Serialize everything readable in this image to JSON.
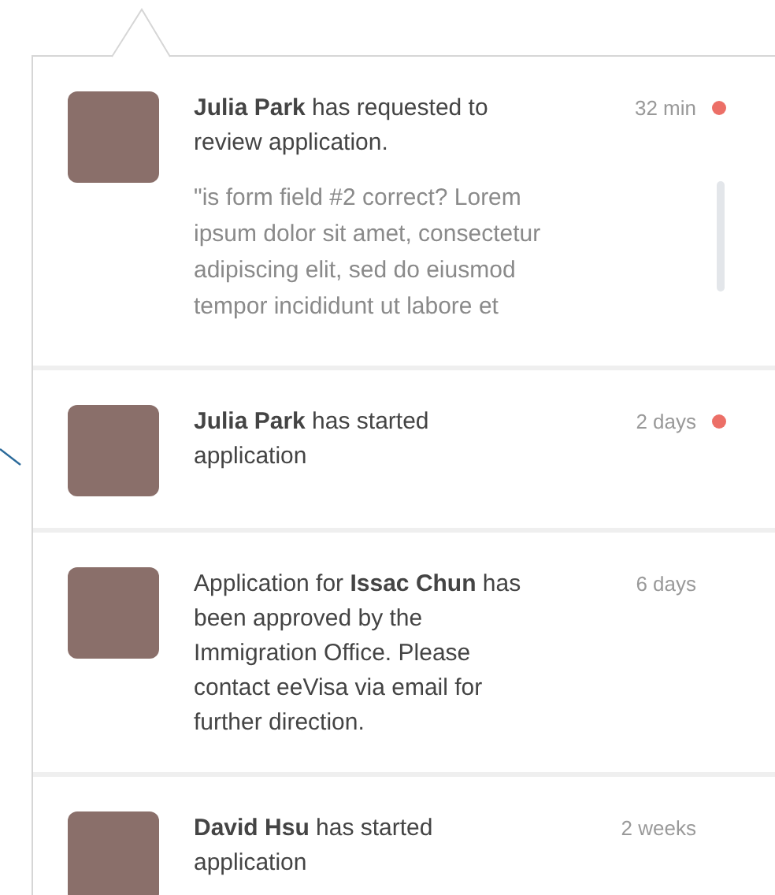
{
  "notifications": [
    {
      "message": "**Julia Park** has requested to review application.",
      "time": "32 min",
      "unread": true,
      "quote": "\"is form field #2 correct? Lorem ipsum dolor sit amet, consectetur adipiscing elit, sed do eiusmod tempor incididunt ut labore et"
    },
    {
      "message": "**Julia Park** has started application",
      "time": "2 days",
      "unread": true
    },
    {
      "message": "Application for **Issac Chun** has been approved by the Immigration Office. Please contact eeVisa via email for further direction.",
      "time": "6 days",
      "unread": false
    },
    {
      "message": "**David Hsu** has started application",
      "time": "2 weeks",
      "unread": false
    }
  ]
}
